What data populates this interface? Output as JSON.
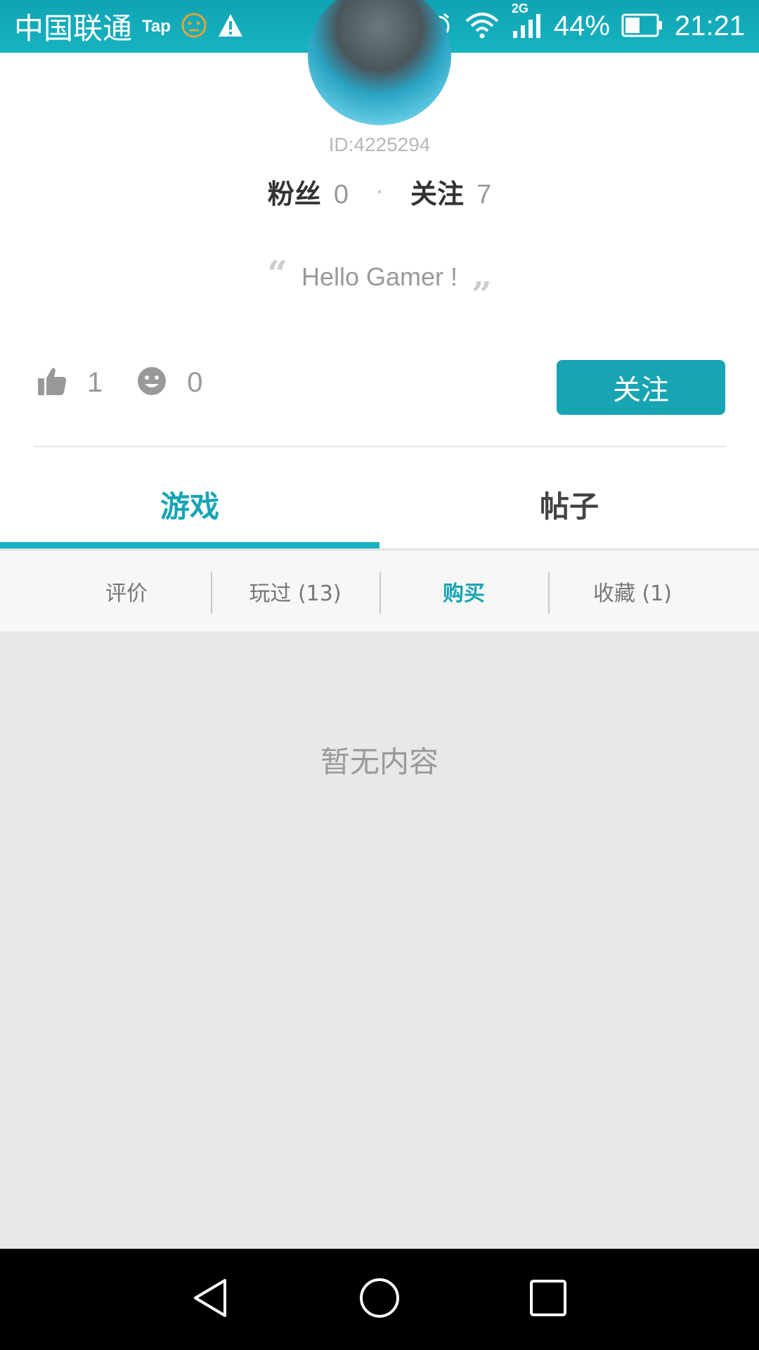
{
  "status_bar": {
    "carrier": "中国联通",
    "tap_label": "Tap",
    "network": "2G",
    "battery": "44%",
    "time": "21:21"
  },
  "profile": {
    "id_text": "ID:4225294",
    "fans_label": "粉丝",
    "fans_count": "0",
    "separator": "·",
    "following_label": "关注",
    "following_count": "7",
    "bio": "Hello Gamer !",
    "likes_count": "1",
    "smile_count": "0",
    "follow_button": "关注"
  },
  "tabs": [
    {
      "label": "游戏",
      "active": true
    },
    {
      "label": "帖子",
      "active": false
    }
  ],
  "subtabs": [
    {
      "label": "评价",
      "active": false
    },
    {
      "label": "玩过 (13)",
      "active": false
    },
    {
      "label": "购买",
      "active": true
    },
    {
      "label": "收藏 (1)",
      "active": false
    }
  ],
  "content": {
    "empty_text": "暂无内容"
  },
  "colors": {
    "accent": "#17a4b3",
    "status_bar": "#17b2c0",
    "content_bg": "#e8e8e8"
  },
  "icons": [
    "face-icon",
    "warning-icon",
    "alarm-icon",
    "wifi-icon",
    "signal-icon",
    "battery-icon",
    "thumbs-up-icon",
    "smile-icon",
    "back-icon",
    "home-icon",
    "recents-icon"
  ]
}
